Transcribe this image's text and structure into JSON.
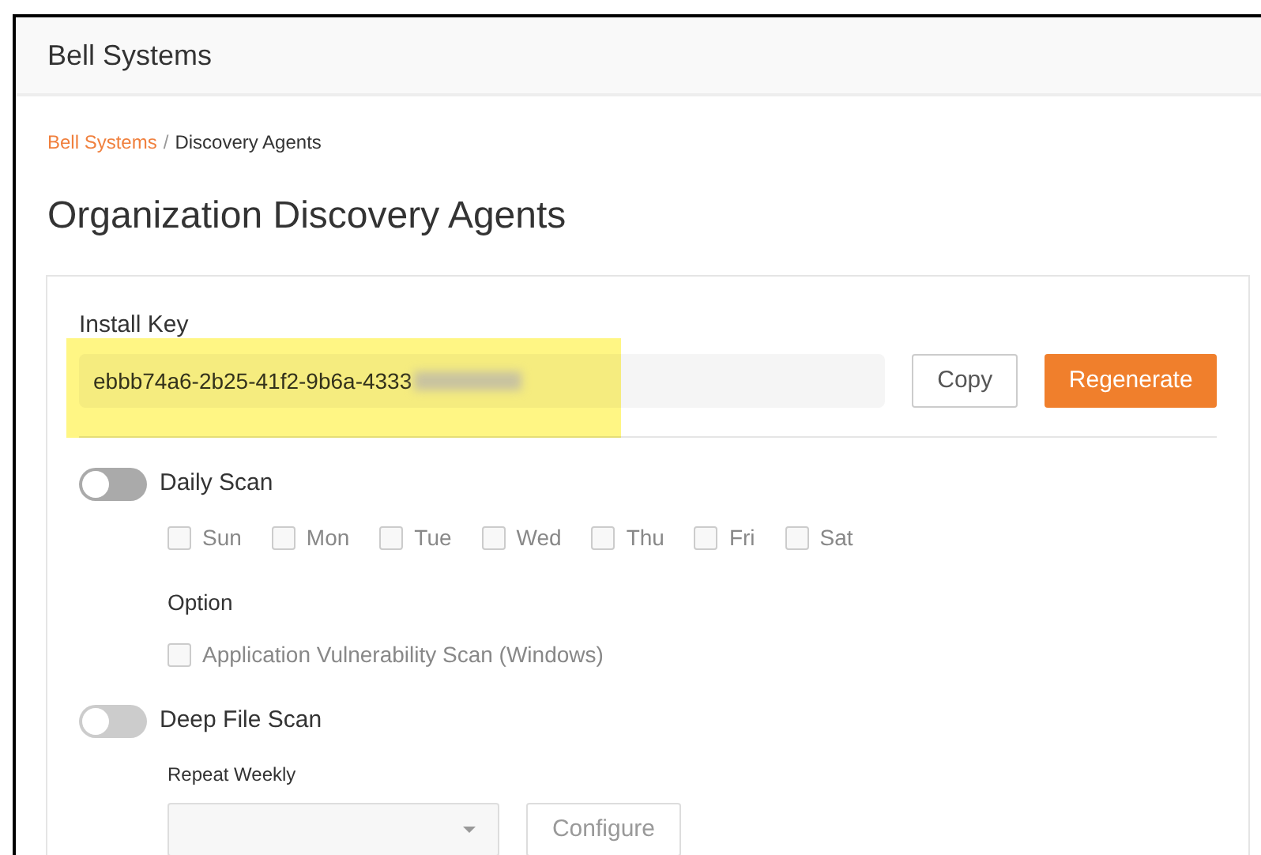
{
  "header": {
    "title": "Bell Systems"
  },
  "breadcrumb_separator": "/",
  "breadcrumb": [
    {
      "label": "Bell Systems",
      "link": true
    },
    {
      "label": "Discovery Agents",
      "link": false
    }
  ],
  "page_title": "Organization Discovery Agents",
  "install_key": {
    "label": "Install Key",
    "value": "ebbb74a6-2b25-41f2-9b6a-4333",
    "redacted": true,
    "highlighted": true,
    "buttons": [
      {
        "label": "Copy",
        "kind": "outline"
      },
      {
        "label": "Regenerate",
        "kind": "primary"
      }
    ]
  },
  "daily_scan": {
    "label": "Daily Scan",
    "on": false,
    "disabled": false,
    "days": [
      {
        "label": "Sun",
        "checked": false
      },
      {
        "label": "Mon",
        "checked": false
      },
      {
        "label": "Tue",
        "checked": false
      },
      {
        "label": "Wed",
        "checked": false
      },
      {
        "label": "Thu",
        "checked": false
      },
      {
        "label": "Fri",
        "checked": false
      },
      {
        "label": "Sat",
        "checked": false
      }
    ],
    "option_heading": "Option",
    "options": [
      {
        "label": "Application Vulnerability Scan (Windows)",
        "checked": false
      }
    ]
  },
  "deep_file_scan": {
    "label": "Deep File Scan",
    "on": false,
    "disabled": true,
    "repeat_label": "Repeat Weekly",
    "configure_button": "Configure"
  }
}
